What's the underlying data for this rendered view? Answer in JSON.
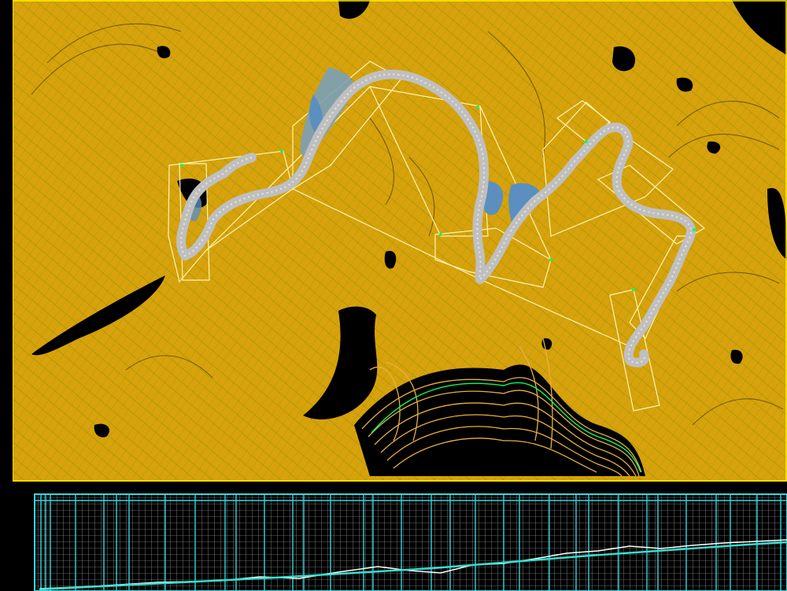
{
  "window": {
    "background": "#000000"
  },
  "plan_view": {
    "terrain_color": "#d9a10c",
    "terrain_hatch_color": "#6fb000",
    "frame_color": "#ffee00",
    "contour_light": "#f2e07a",
    "contour_highlight": "#00ff66",
    "alignment_box_color": "#fff3b0",
    "road_color": "#bfbfbf",
    "cut_fill_color": "#5a8fbf"
  },
  "profile_view": {
    "grid_color": "#ffffff",
    "major_grid_color": "#35d6e0",
    "ground_line_color": "#ffffff",
    "design_line_color": "#35e0d0",
    "frame_color": "#35d6e0"
  }
}
